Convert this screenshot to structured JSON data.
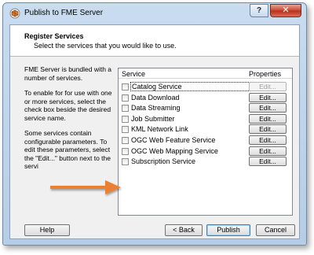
{
  "window": {
    "title": "Publish to FME Server",
    "help_label": "?",
    "close_label": "✕"
  },
  "header": {
    "title": "Register Services",
    "subtitle": "Select the services that you would like to use."
  },
  "info": {
    "p1": "FME Server is bundled with a number of services.",
    "p2": "To enable for for use with one or more services, select the check box beside the desired service name.",
    "p3": "Some services contain configurable parameters. To edit these parameters, select the \"Edit...\" button next to the servi"
  },
  "services": {
    "col_service": "Service",
    "col_properties": "Properties",
    "rows": [
      {
        "name": "Catalog Service",
        "edit": "Edit...",
        "edit_enabled": false,
        "checked": false
      },
      {
        "name": "Data Download",
        "edit": "Edit...",
        "edit_enabled": true,
        "checked": false
      },
      {
        "name": "Data Streaming",
        "edit": "Edit...",
        "edit_enabled": true,
        "checked": false
      },
      {
        "name": "Job Submitter",
        "edit": "Edit...",
        "edit_enabled": true,
        "checked": false
      },
      {
        "name": "KML Network Link",
        "edit": "Edit...",
        "edit_enabled": true,
        "checked": false
      },
      {
        "name": "OGC Web Feature Service",
        "edit": "Edit...",
        "edit_enabled": true,
        "checked": false
      },
      {
        "name": "OGC Web Mapping Service",
        "edit": "Edit...",
        "edit_enabled": true,
        "checked": false
      },
      {
        "name": "Subscription Service",
        "edit": "Edit...",
        "edit_enabled": true,
        "checked": false
      }
    ]
  },
  "footer": {
    "help": "Help",
    "back": "< Back",
    "publish": "Publish",
    "cancel": "Cancel"
  },
  "colors": {
    "arrow": "#ee7f2d",
    "title_bar": "#c9dcf0",
    "close_button": "#c7452e"
  }
}
